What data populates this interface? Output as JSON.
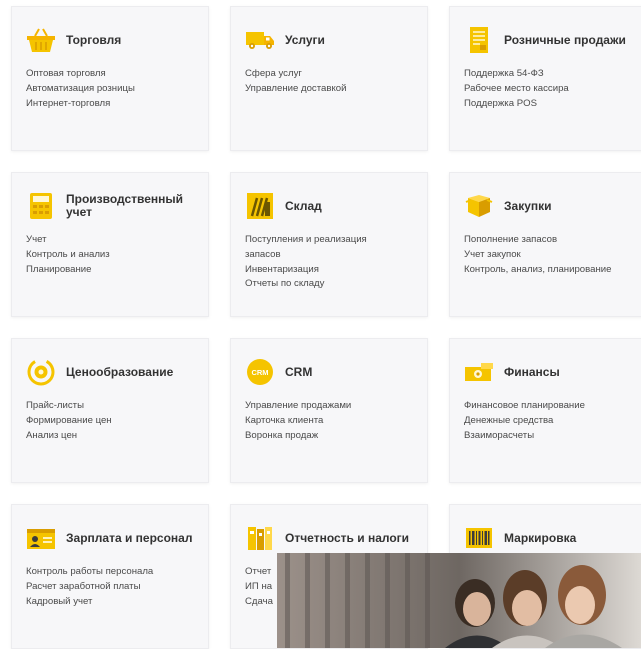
{
  "colors": {
    "accent": "#f5c400",
    "card_bg": "#f7f7f9"
  },
  "cards": [
    {
      "title": "Торговля",
      "icon": "basket-icon",
      "items": [
        "Оптовая торговля",
        "Автоматизация розницы",
        "Интернет-торговля"
      ]
    },
    {
      "title": "Услуги",
      "icon": "delivery-truck-icon",
      "items": [
        "Сфера услуг",
        "Управление доставкой"
      ]
    },
    {
      "title": "Розничные продажи",
      "icon": "receipt-document-icon",
      "items": [
        "Поддержка 54-ФЗ",
        "Рабочее место кассира",
        "Поддержка POS"
      ]
    },
    {
      "title": "Производственный учет",
      "icon": "calculator-icon",
      "items": [
        "Учет",
        "Контроль и анализ",
        "Планирование"
      ]
    },
    {
      "title": "Склад",
      "icon": "warehouse-icon",
      "items": [
        "Поступления и реализация запасов",
        "Инвентаризация",
        "Отчеты по складу"
      ]
    },
    {
      "title": "Закупки",
      "icon": "box-icon",
      "items": [
        "Пополнение запасов",
        "Учет закупок",
        "Контроль, анализ, планирование"
      ]
    },
    {
      "title": "Ценообразование",
      "icon": "price-coin-icon",
      "items": [
        "Прайс-листы",
        "Формирование цен",
        "Анализ цен"
      ]
    },
    {
      "title": "CRM",
      "icon": "crm-badge-icon",
      "badge": "CRM",
      "items": [
        "Управление продажами",
        "Карточка клиента",
        "Воронка продаж"
      ]
    },
    {
      "title": "Финансы",
      "icon": "banknote-icon",
      "items": [
        "Финансовое планирование",
        "Денежные средства",
        "Взаиморасчеты"
      ]
    },
    {
      "title": "Зарплата и персонал",
      "icon": "id-card-icon",
      "items": [
        "Контроль работы персонала",
        "Расчет заработной платы",
        "Кадровый учет"
      ]
    },
    {
      "title": "Отчетность и налоги",
      "icon": "folders-icon",
      "items": [
        "Отчет",
        "ИП на",
        "Сдача"
      ]
    },
    {
      "title": "Маркировка",
      "icon": "barcode-icon",
      "items": []
    }
  ]
}
